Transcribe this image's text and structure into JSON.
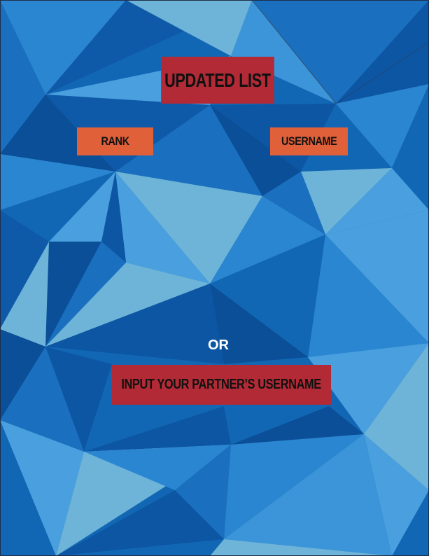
{
  "header": {
    "title": "UPDATED LIST"
  },
  "columns": {
    "rank_label": "RANK",
    "username_label": "USERNAME"
  },
  "divider": {
    "or_label": "OR"
  },
  "partner": {
    "input_label": "INPUT YOUR PARTNER’S USERNAME"
  },
  "colors": {
    "background_blue": "#0f5fa8",
    "title_red": "#b22a35",
    "label_orange": "#e0603a"
  }
}
